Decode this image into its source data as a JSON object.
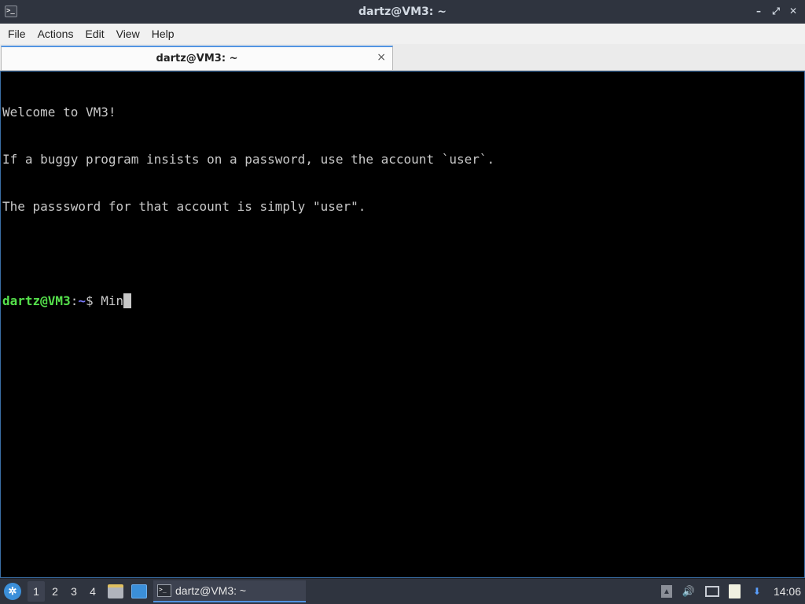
{
  "window": {
    "title": "dartz@VM3: ~",
    "app_icon": ">_",
    "buttons": {
      "minimize": "–",
      "maximize": "⤢",
      "close": "✕"
    }
  },
  "menu": {
    "items": [
      "File",
      "Actions",
      "Edit",
      "View",
      "Help"
    ]
  },
  "tabs": [
    {
      "label": "dartz@VM3: ~",
      "close": "×",
      "active": true
    }
  ],
  "terminal": {
    "lines": [
      "Welcome to VM3!",
      "If a buggy program insists on a password, use the account `user`.",
      "The passsword for that account is simply \"user\".",
      ""
    ],
    "prompt": {
      "user_host": "dartz@VM3",
      "separator": ":",
      "path": "~",
      "symbol": "$ ",
      "input": "Min"
    },
    "colors": {
      "background": "#000000",
      "text": "#c8c8c8",
      "user": "#55e04b",
      "path": "#7a7aff"
    }
  },
  "taskbar": {
    "start_icon": "start-menu-icon",
    "desktops": [
      "1",
      "2",
      "3",
      "4"
    ],
    "active_desktop": "1",
    "task": {
      "label": "dartz@VM3: ~",
      "icon": ">_"
    },
    "tray": {
      "up_arrow": "▲",
      "volume": "🔊",
      "update": "⬇"
    },
    "clock": "14:06"
  }
}
